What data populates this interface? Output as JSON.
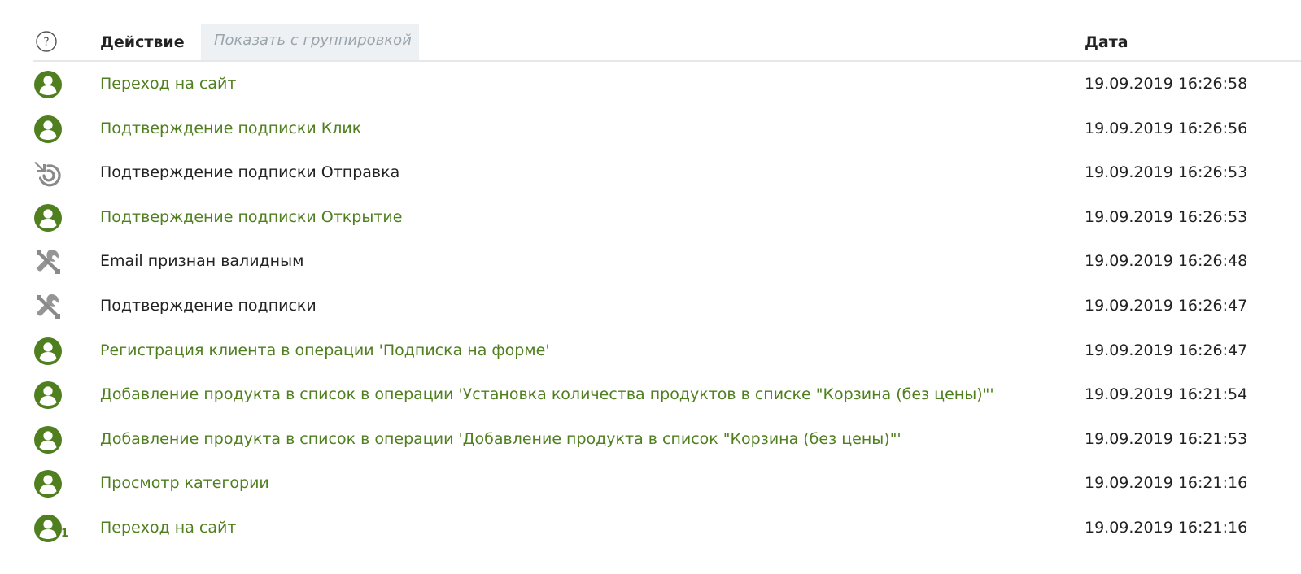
{
  "header": {
    "action_label": "Действие",
    "group_toggle_label": "Показать с группировкой",
    "date_label": "Дата",
    "help_symbol": "?"
  },
  "colors": {
    "client_action": "#4f7f1f",
    "system_action": "#222222",
    "icon_green": "#4f7f1f",
    "icon_gray": "#8a8a8a"
  },
  "rows": [
    {
      "icon": "user-icon",
      "kind": "client",
      "title": "Переход на сайт",
      "date": "19.09.2019 16:26:58"
    },
    {
      "icon": "user-icon",
      "kind": "client",
      "title": "Подтверждение подписки Клик",
      "date": "19.09.2019 16:26:56"
    },
    {
      "icon": "mailing-icon",
      "kind": "system",
      "title": "Подтверждение подписки Отправка",
      "date": "19.09.2019 16:26:53"
    },
    {
      "icon": "user-icon",
      "kind": "client",
      "title": "Подтверждение подписки Открытие",
      "date": "19.09.2019 16:26:53"
    },
    {
      "icon": "tools-icon",
      "kind": "system",
      "title": "Email признан валидным",
      "date": "19.09.2019 16:26:48"
    },
    {
      "icon": "tools-icon",
      "kind": "system",
      "title": "Подтверждение подписки",
      "date": "19.09.2019 16:26:47"
    },
    {
      "icon": "user-icon",
      "kind": "client",
      "title": "Регистрация клиента в операции 'Подписка на форме'",
      "date": "19.09.2019 16:26:47"
    },
    {
      "icon": "user-icon",
      "kind": "client",
      "title": "Добавление продукта в список в операции 'Установка количества продуктов в списке \"Корзина (без цены)\"'",
      "date": "19.09.2019 16:21:54"
    },
    {
      "icon": "user-icon",
      "kind": "client",
      "title": "Добавление продукта в список в операции 'Добавление продукта в список \"Корзина (без цены)\"'",
      "date": "19.09.2019 16:21:53"
    },
    {
      "icon": "user-icon",
      "kind": "client",
      "title": "Просмотр категории",
      "date": "19.09.2019 16:21:16"
    },
    {
      "icon": "user-icon",
      "kind": "client",
      "title": "Переход на сайт",
      "date": "19.09.2019 16:21:16",
      "badge": "1"
    }
  ]
}
